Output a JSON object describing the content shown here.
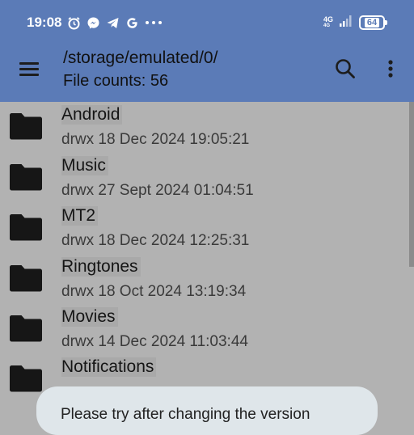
{
  "status_bar": {
    "time": "19:08",
    "icons": [
      "alarm-icon",
      "messenger-icon",
      "telegram-icon",
      "google-icon",
      "more-dots-icon"
    ],
    "network_top": "4G",
    "network_bottom": "4G",
    "battery": "64"
  },
  "app_bar": {
    "path": "/storage/emulated/0/",
    "file_count": "File counts: 56",
    "accent": "#5b7bb7"
  },
  "files": [
    {
      "name": "Android",
      "meta": "drwx 18 Dec 2024 19:05:21"
    },
    {
      "name": "Music",
      "meta": "drwx 27 Sept 2024 01:04:51"
    },
    {
      "name": "MT2",
      "meta": "drwx 18 Dec 2024 12:25:31"
    },
    {
      "name": "Ringtones",
      "meta": "drwx 18 Oct 2024 13:19:34"
    },
    {
      "name": "Movies",
      "meta": "drwx 14 Dec 2024 11:03:44"
    },
    {
      "name": "Notifications",
      "meta": ""
    }
  ],
  "toast": {
    "text": "Please try after changing the version"
  }
}
